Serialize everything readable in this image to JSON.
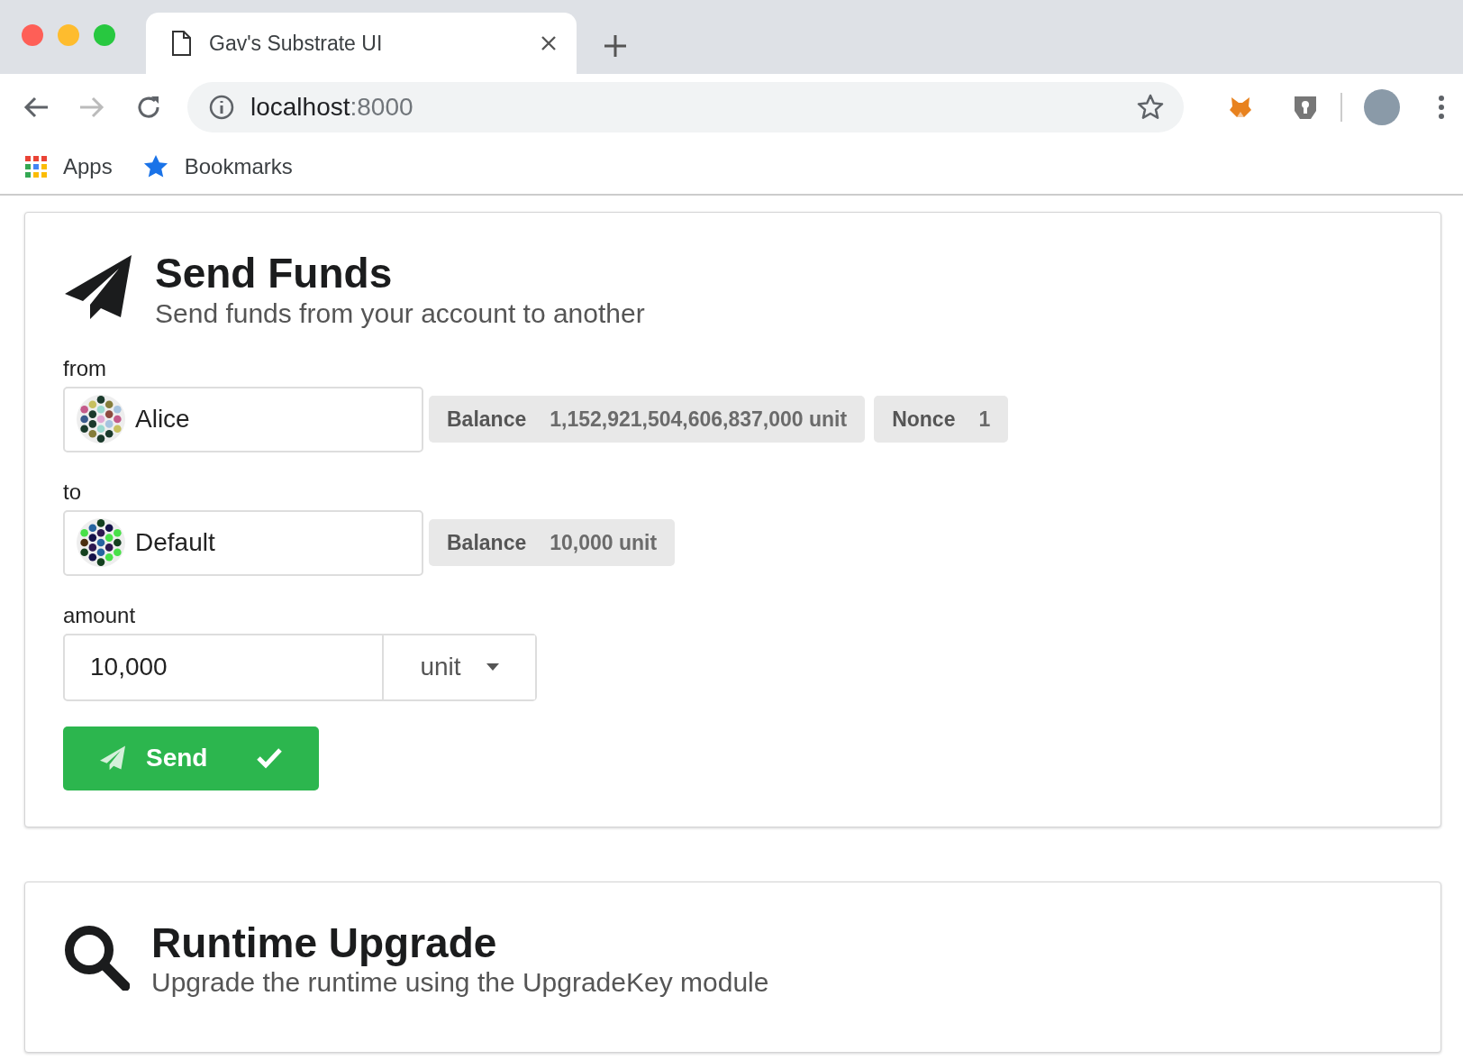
{
  "browser": {
    "tab": {
      "title": "Gav's Substrate UI"
    },
    "address": {
      "host": "localhost",
      "port": ":8000"
    },
    "bookmarks": [
      {
        "label": "Apps",
        "kind": "apps"
      },
      {
        "label": "Bookmarks",
        "kind": "star"
      }
    ]
  },
  "send_funds": {
    "title": "Send Funds",
    "subtitle": "Send funds from your account to another",
    "fields": [
      {
        "label": "from",
        "account": "Alice",
        "badges": [
          {
            "label": "Balance",
            "value": "1,152,921,504,606,837,000 unit"
          },
          {
            "label": "Nonce",
            "value": "1"
          }
        ]
      },
      {
        "label": "to",
        "account": "Default",
        "badges": [
          {
            "label": "Balance",
            "value": "10,000 unit"
          }
        ]
      }
    ],
    "amount": {
      "label": "amount",
      "value": "10,000",
      "unit": "unit"
    },
    "send_button": {
      "label": "Send"
    }
  },
  "runtime_upgrade": {
    "title": "Runtime Upgrade",
    "subtitle": "Upgrade the runtime using the UpgradeKey module"
  }
}
